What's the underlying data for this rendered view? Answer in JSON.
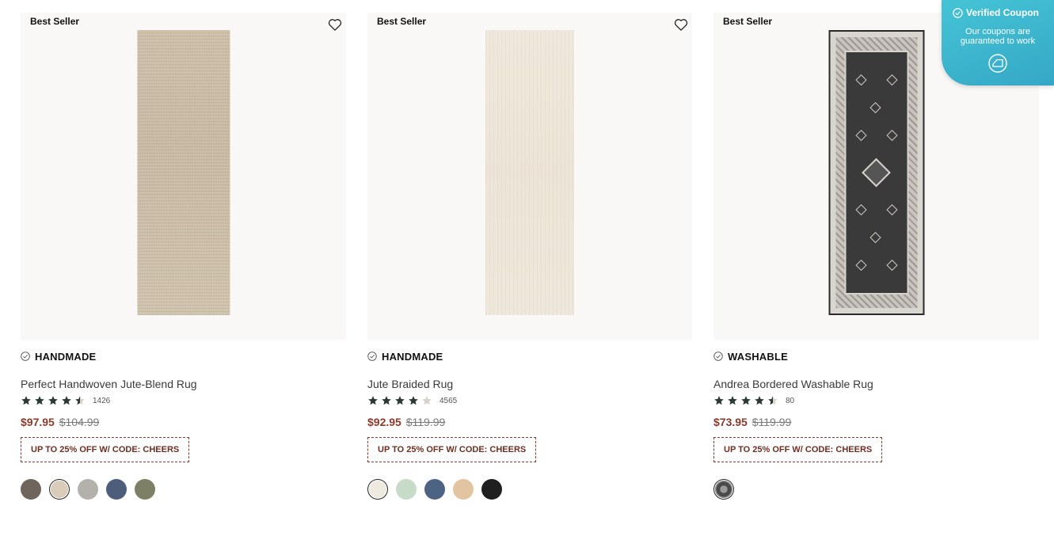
{
  "products": [
    {
      "badge": "Best Seller",
      "tag": "HANDMADE",
      "title": "Perfect Handwoven Jute-Blend Rug",
      "rating": 4.5,
      "review_count": "1426",
      "price": "$97.95",
      "original_price": "$104.99",
      "coupon": "UP TO 25% OFF W/ CODE: CHEERS",
      "swatches": [
        "#6f655c",
        "#d9ccb8",
        "#b4b1ad",
        "#4e5d7a",
        "#7d8064"
      ],
      "selected_swatch": 1
    },
    {
      "badge": "Best Seller",
      "tag": "HANDMADE",
      "title": "Jute Braided Rug",
      "rating": 4.0,
      "review_count": "4565",
      "price": "$92.95",
      "original_price": "$119.99",
      "coupon": "UP TO 25% OFF W/ CODE: CHEERS",
      "swatches": [
        "#efeae0",
        "#c6dcc8",
        "#4d6384",
        "#e2c4a1",
        "#1f1f1f"
      ],
      "selected_swatch": 0
    },
    {
      "badge": "Best Seller",
      "tag": "WASHABLE",
      "title": "Andrea Bordered Washable Rug",
      "rating": 4.5,
      "review_count": "80",
      "price": "$73.95",
      "original_price": "$119.99",
      "coupon": "UP TO 25% OFF W/ CODE: CHEERS",
      "swatches": [
        "#5c5c5c"
      ],
      "selected_swatch": 0
    }
  ],
  "coupon_widget": {
    "title": "Verified Coupon",
    "subtitle_line1": "Our coupons are",
    "subtitle_line2": "guaranteed to work"
  },
  "colors": {
    "price": "#8a3a2a",
    "star": "#2b3a37",
    "star_empty": "#d9d2c8",
    "coupon_border": "#8a3a2a",
    "coupon_widget_bg": "#3db6d0"
  }
}
